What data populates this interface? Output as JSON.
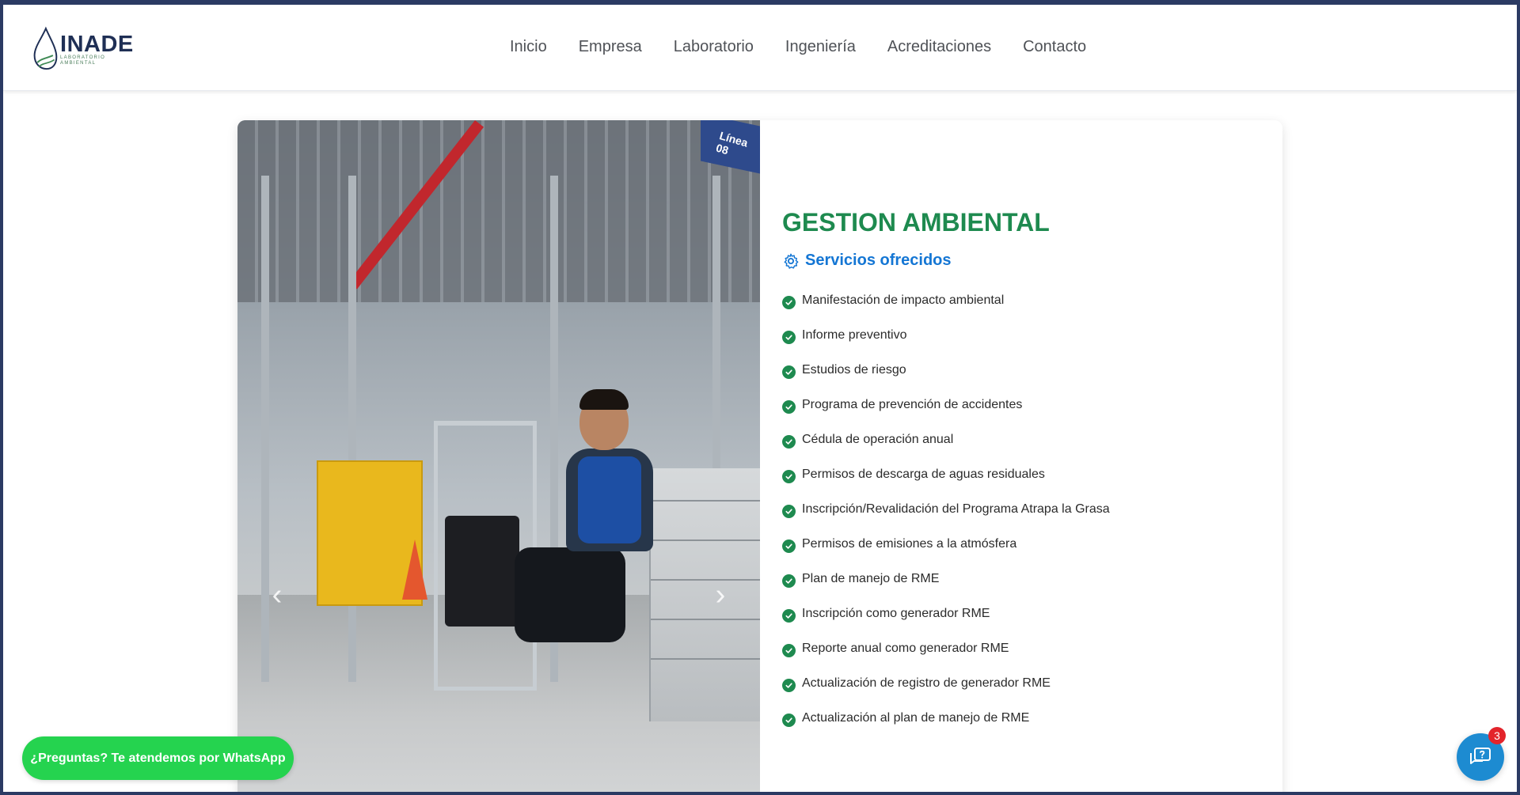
{
  "brand": {
    "name": "INADE",
    "tagline": "LABORATORIO AMBIENTAL"
  },
  "nav": {
    "items": [
      {
        "label": "Inicio"
      },
      {
        "label": "Empresa"
      },
      {
        "label": "Laboratorio"
      },
      {
        "label": "Ingeniería"
      },
      {
        "label": "Acreditaciones"
      },
      {
        "label": "Contacto"
      }
    ]
  },
  "hero": {
    "image_sign": "Línea 08",
    "prev_arrow": "‹",
    "next_arrow": "›"
  },
  "section": {
    "title": "GESTION AMBIENTAL",
    "subtitle": "Servicios ofrecidos",
    "services": [
      "Manifestación de impacto ambiental",
      "Informe preventivo",
      "Estudios de riesgo",
      "Programa de prevención de accidentes",
      "Cédula de operación anual",
      "Permisos de descarga de aguas residuales",
      "Inscripción/Revalidación del Programa Atrapa la Grasa",
      "Permisos de emisiones a la atmósfera",
      "Plan de manejo de RME",
      "Inscripción como generador RME",
      "Reporte anual como generador RME",
      "Actualización de registro de generador RME",
      "Actualización al plan de manejo de RME"
    ]
  },
  "whatsapp": {
    "label": "¿Preguntas? Te atendemos por WhatsApp"
  },
  "chat": {
    "badge_count": "3"
  },
  "colors": {
    "title_green": "#1e8a4f",
    "subtitle_blue": "#1476d4",
    "whatsapp_green": "#25d34f",
    "chat_blue": "#1d8bd1",
    "badge_red": "#e3242b",
    "frame_navy": "#2b3a63"
  },
  "icons": {
    "subtitle": "gear-icon",
    "service_bullet": "check-circle-icon",
    "chat": "chat-question-icon"
  }
}
